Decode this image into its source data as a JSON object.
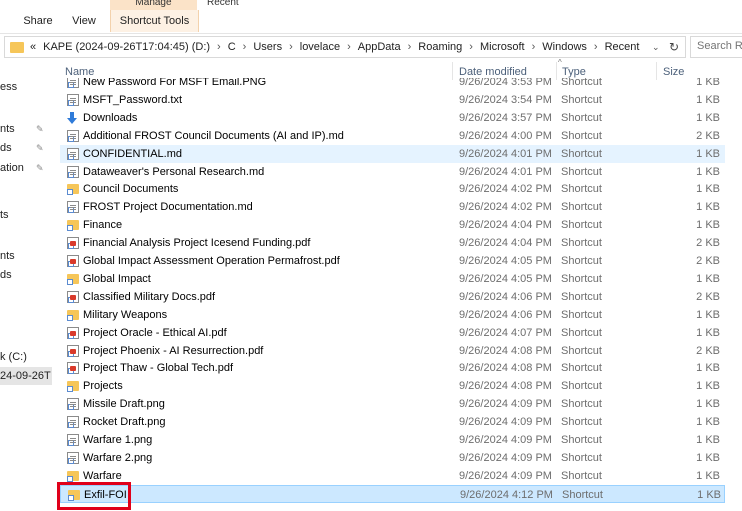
{
  "ribbon": {
    "context_header": "Manage",
    "context_header_2": "Recent",
    "tabs": [
      "Share",
      "View",
      "Shortcut Tools"
    ]
  },
  "address": {
    "crumbs": [
      "«",
      "KAPE (2024-09-26T17:04:45) (D:)",
      "C",
      "Users",
      "lovelace",
      "AppData",
      "Roaming",
      "Microsoft",
      "Windows",
      "Recent"
    ],
    "search_placeholder": "Search Re"
  },
  "nav": {
    "items": [
      {
        "label": "ess",
        "pinned": false,
        "selected": false
      },
      {
        "label": "nts",
        "pinned": true,
        "selected": false
      },
      {
        "label": "ds",
        "pinned": true,
        "selected": false
      },
      {
        "label": "ation",
        "pinned": true,
        "selected": false
      },
      {
        "label": "ts",
        "pinned": false,
        "selected": false
      },
      {
        "label": "nts",
        "pinned": false,
        "selected": false
      },
      {
        "label": "ds",
        "pinned": false,
        "selected": false
      },
      {
        "label": "k (C:)",
        "pinned": false,
        "selected": false
      },
      {
        "label": "24-09-26T",
        "pinned": false,
        "selected": true
      }
    ]
  },
  "columns": {
    "name": "Name",
    "date": "Date modified",
    "type": "Type",
    "size": "Size"
  },
  "files": [
    {
      "name": "New Password For MSFT Email.PNG",
      "date": "9/26/2024 3:53 PM",
      "type": "Shortcut",
      "size": "1 KB",
      "icon": "file-icon",
      "state": ""
    },
    {
      "name": "MSFT_Password.txt",
      "date": "9/26/2024 3:54 PM",
      "type": "Shortcut",
      "size": "1 KB",
      "icon": "file-icon",
      "state": ""
    },
    {
      "name": "Downloads",
      "date": "9/26/2024 3:57 PM",
      "type": "Shortcut",
      "size": "1 KB",
      "icon": "download-icon",
      "state": ""
    },
    {
      "name": "Additional FROST Council Documents (AI and IP).md",
      "date": "9/26/2024 4:00 PM",
      "type": "Shortcut",
      "size": "2 KB",
      "icon": "file-icon",
      "state": ""
    },
    {
      "name": "CONFIDENTIAL.md",
      "date": "9/26/2024 4:01 PM",
      "type": "Shortcut",
      "size": "1 KB",
      "icon": "file-icon",
      "state": "hover"
    },
    {
      "name": "Dataweaver's Personal Research.md",
      "date": "9/26/2024 4:01 PM",
      "type": "Shortcut",
      "size": "1 KB",
      "icon": "file-icon",
      "state": ""
    },
    {
      "name": "Council Documents",
      "date": "9/26/2024 4:02 PM",
      "type": "Shortcut",
      "size": "1 KB",
      "icon": "folder-icon",
      "state": ""
    },
    {
      "name": "FROST Project Documentation.md",
      "date": "9/26/2024 4:02 PM",
      "type": "Shortcut",
      "size": "1 KB",
      "icon": "file-icon",
      "state": ""
    },
    {
      "name": "Finance",
      "date": "9/26/2024 4:04 PM",
      "type": "Shortcut",
      "size": "1 KB",
      "icon": "folder-icon",
      "state": ""
    },
    {
      "name": "Financial Analysis Project Icesend Funding.pdf",
      "date": "9/26/2024 4:04 PM",
      "type": "Shortcut",
      "size": "2 KB",
      "icon": "pdf-icon",
      "state": ""
    },
    {
      "name": "Global Impact Assessment Operation Permafrost.pdf",
      "date": "9/26/2024 4:05 PM",
      "type": "Shortcut",
      "size": "2 KB",
      "icon": "pdf-icon",
      "state": ""
    },
    {
      "name": "Global Impact",
      "date": "9/26/2024 4:05 PM",
      "type": "Shortcut",
      "size": "1 KB",
      "icon": "folder-icon",
      "state": ""
    },
    {
      "name": "Classified Military Docs.pdf",
      "date": "9/26/2024 4:06 PM",
      "type": "Shortcut",
      "size": "2 KB",
      "icon": "pdf-icon",
      "state": ""
    },
    {
      "name": "Military Weapons",
      "date": "9/26/2024 4:06 PM",
      "type": "Shortcut",
      "size": "1 KB",
      "icon": "folder-icon",
      "state": ""
    },
    {
      "name": "Project Oracle - Ethical AI.pdf",
      "date": "9/26/2024 4:07 PM",
      "type": "Shortcut",
      "size": "1 KB",
      "icon": "pdf-icon",
      "state": ""
    },
    {
      "name": "Project Phoenix - AI Resurrection.pdf",
      "date": "9/26/2024 4:08 PM",
      "type": "Shortcut",
      "size": "2 KB",
      "icon": "pdf-icon",
      "state": ""
    },
    {
      "name": "Project Thaw - Global Tech.pdf",
      "date": "9/26/2024 4:08 PM",
      "type": "Shortcut",
      "size": "1 KB",
      "icon": "pdf-icon",
      "state": ""
    },
    {
      "name": "Projects",
      "date": "9/26/2024 4:08 PM",
      "type": "Shortcut",
      "size": "1 KB",
      "icon": "folder-icon",
      "state": ""
    },
    {
      "name": "Missile Draft.png",
      "date": "9/26/2024 4:09 PM",
      "type": "Shortcut",
      "size": "1 KB",
      "icon": "file-icon",
      "state": ""
    },
    {
      "name": "Rocket Draft.png",
      "date": "9/26/2024 4:09 PM",
      "type": "Shortcut",
      "size": "1 KB",
      "icon": "file-icon",
      "state": ""
    },
    {
      "name": "Warfare 1.png",
      "date": "9/26/2024 4:09 PM",
      "type": "Shortcut",
      "size": "1 KB",
      "icon": "file-icon",
      "state": ""
    },
    {
      "name": "Warfare 2.png",
      "date": "9/26/2024 4:09 PM",
      "type": "Shortcut",
      "size": "1 KB",
      "icon": "file-icon",
      "state": ""
    },
    {
      "name": "Warfare",
      "date": "9/26/2024 4:09 PM",
      "type": "Shortcut",
      "size": "1 KB",
      "icon": "folder-icon",
      "state": ""
    },
    {
      "name": "Exfil-FOI",
      "date": "9/26/2024 4:12 PM",
      "type": "Shortcut",
      "size": "1 KB",
      "icon": "folder-icon",
      "state": "selected"
    }
  ],
  "colors": {
    "accent": "#cce8ff",
    "hover": "#e5f3ff",
    "annotation": "#e0001a"
  }
}
